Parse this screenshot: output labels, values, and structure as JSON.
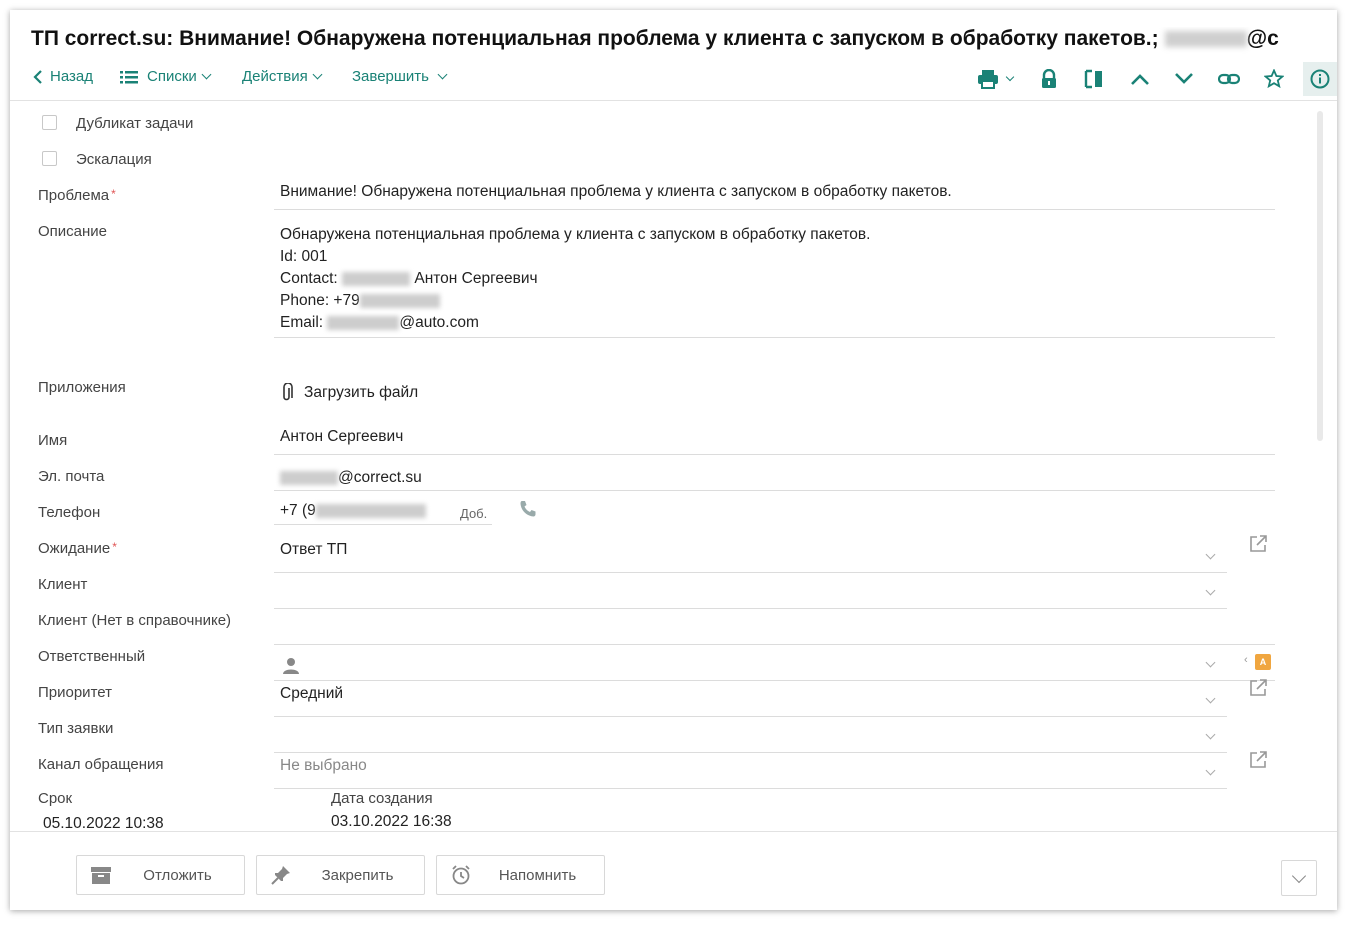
{
  "header": {
    "title": "ТП correct.su: Внимание! Обнаружена потенциальная проблема у клиента с запуском в обработку пакетов.;",
    "title_suffix": "@c"
  },
  "toolbar": {
    "back_label": "Назад",
    "lists_label": "Списки",
    "actions_label": "Действия",
    "finish_label": "Завершить"
  },
  "form": {
    "duplicate_label": "Дубликат задачи",
    "escalation_label": "Эскалация",
    "problem_label": "Проблема",
    "problem_value": "Внимание! Обнаружена потенциальная проблема у клиента с запуском в обработку пакетов.",
    "description_label": "Описание",
    "description_line1": "Обнаружена потенциальная проблема у клиента с запуском в обработку пакетов.",
    "description_line2": "Id: 001",
    "description_contact_prefix": "Contact:",
    "description_contact_name": "Антон Сергеевич",
    "description_phone_prefix": "Phone: +79",
    "description_email_prefix": "Email:",
    "description_email_suffix": "@auto.com",
    "attachments_label": "Приложения",
    "upload_label": "Загрузить файл",
    "name_label": "Имя",
    "name_value": "Антон Сергеевич",
    "email_label": "Эл. почта",
    "email_suffix": "@correct.su",
    "phone_label": "Телефон",
    "phone_prefix": "+7 (9",
    "phone_ext_label": "Доб.",
    "waiting_label": "Ожидание",
    "waiting_value": "Ответ ТП",
    "client_label": "Клиент",
    "client_unlisted_label": "Клиент (Нет в справочнике)",
    "responsible_label": "Ответственный",
    "priority_label": "Приоритет",
    "priority_value": "Средний",
    "ticket_type_label": "Тип заявки",
    "channel_label": "Канал обращения",
    "channel_placeholder": "Не выбрано",
    "deadline_label": "Срок",
    "deadline_value": "05.10.2022 10:38",
    "created_label": "Дата создания",
    "created_value": "03.10.2022 16:38",
    "required_mark": "*",
    "badge_letter": "A"
  },
  "footer": {
    "postpone_label": "Отложить",
    "pin_label": "Закрепить",
    "remind_label": "Напомнить"
  },
  "colors": {
    "accent": "#1a8276",
    "required": "#e05555",
    "badge": "#f0a640"
  }
}
